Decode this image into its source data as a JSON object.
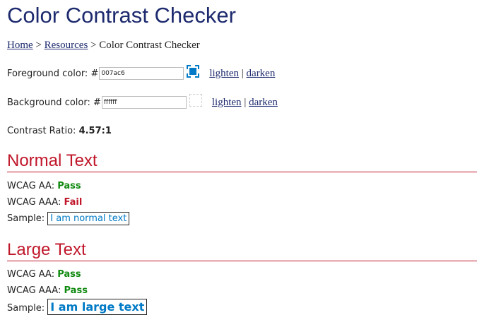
{
  "page": {
    "title": "Color Contrast Checker"
  },
  "breadcrumb": {
    "home": "Home",
    "sep1": " > ",
    "resources": "Resources",
    "sep2": " > ",
    "current": "Color Contrast Checker"
  },
  "foreground": {
    "label": "Foreground color: #",
    "value": "007ac6",
    "swatch_color": "#007ac6",
    "lighten": "lighten",
    "divider": "|",
    "darken": "darken"
  },
  "background": {
    "label": "Background color: #",
    "value": "ffffff",
    "swatch_color": "#ffffff",
    "lighten": "lighten",
    "divider": "|",
    "darken": "darken"
  },
  "contrast": {
    "label": "Contrast Ratio: ",
    "value": "4.57:1"
  },
  "normal_text": {
    "heading": "Normal Text",
    "aa_label": "WCAG AA: ",
    "aa_result": "Pass",
    "aaa_label": "WCAG AAA: ",
    "aaa_result": "Fail",
    "sample_label": "Sample: ",
    "sample_text": "I am normal text"
  },
  "large_text": {
    "heading": "Large Text",
    "aa_label": "WCAG AA: ",
    "aa_result": "Pass",
    "aaa_label": "WCAG AAA: ",
    "aaa_result": "Pass",
    "sample_label": "Sample: ",
    "sample_text": "I am large text"
  },
  "colors": {
    "title": "#1d2a6e",
    "section_heading": "#c0172a",
    "pass": "#118a11",
    "fail": "#c0172a",
    "sample_text": "#007ac6"
  }
}
